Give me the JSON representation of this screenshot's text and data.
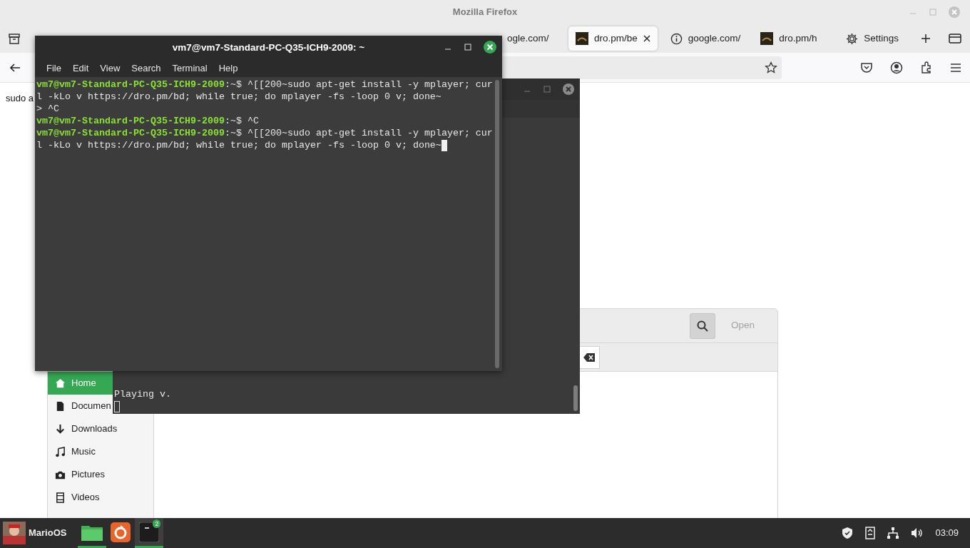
{
  "firefox": {
    "title": "Mozilla Firefox",
    "tabs": [
      {
        "label": "ogle.com/",
        "kind": "plain",
        "selected": false
      },
      {
        "label": "dro.pm/be",
        "kind": "site",
        "selected": true
      },
      {
        "label": "google.com/",
        "kind": "info",
        "selected": false
      },
      {
        "label": "dro.pm/h",
        "kind": "site",
        "selected": false
      },
      {
        "label": "Settings",
        "kind": "settings",
        "selected": false
      }
    ],
    "page_text": "sudo a"
  },
  "file_dialog": {
    "open_button": "Open",
    "places": [
      {
        "label": "Home",
        "kind": "home",
        "selected": true
      },
      {
        "label": "Documen",
        "kind": "documents",
        "selected": false
      },
      {
        "label": "Downloads",
        "kind": "downloads",
        "selected": false
      },
      {
        "label": "Music",
        "kind": "music",
        "selected": false
      },
      {
        "label": "Pictures",
        "kind": "pictures",
        "selected": false
      },
      {
        "label": "Videos",
        "kind": "videos",
        "selected": false
      }
    ]
  },
  "player_terminal": {
    "output": "Playing v.",
    "cursor": true
  },
  "terminal": {
    "title": "vm7@vm7-Standard-PC-Q35-ICH9-2009: ~",
    "menu": [
      "File",
      "Edit",
      "View",
      "Search",
      "Terminal",
      "Help"
    ],
    "lines": [
      {
        "prompt": "vm7@vm7-Standard-PC-Q35-ICH9-2009",
        "text": ":~$ ^[[200~sudo apt-get install -y mplayer; cur",
        "cursor": false
      },
      {
        "text": "l -kLo v https://dro.pm/bd; while true; do mplayer -fs -loop 0 v; done~",
        "cursor": false
      },
      {
        "text": "> ^C",
        "cursor": false
      },
      {
        "prompt": "vm7@vm7-Standard-PC-Q35-ICH9-2009",
        "text": ":~$ ^C",
        "cursor": false
      },
      {
        "prompt": "vm7@vm7-Standard-PC-Q35-ICH9-2009",
        "text": ":~$ ^[[200~sudo apt-get install -y mplayer; cur",
        "cursor": false
      },
      {
        "text": "l -kLo v https://dro.pm/bd; while true; do mplayer -fs -loop 0 v; done~",
        "cursor": true
      }
    ]
  },
  "taskbar": {
    "menu_label": "MarioOS",
    "apps": [
      {
        "kind": "files",
        "running": true
      },
      {
        "kind": "firefox",
        "running": false
      },
      {
        "kind": "terminal",
        "running": true,
        "badge": "2"
      }
    ],
    "clock": "03:09"
  }
}
